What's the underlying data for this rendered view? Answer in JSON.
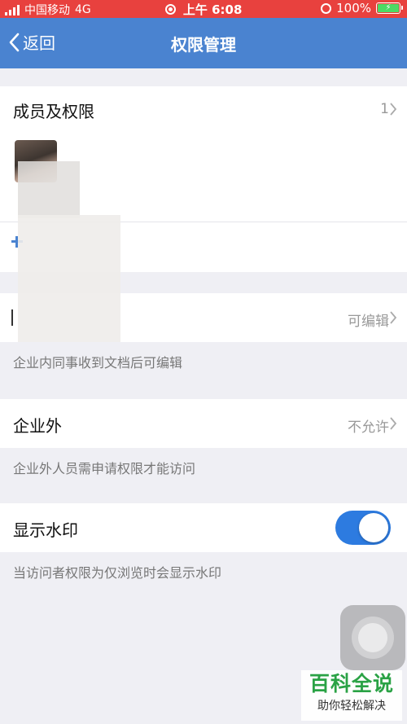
{
  "status_bar": {
    "carrier": "中国移动",
    "network": "4G",
    "time": "上午 6:08",
    "battery": "100%"
  },
  "nav": {
    "back_label": "返回",
    "title": "权限管理"
  },
  "members": {
    "label": "成员及权限",
    "count": "1"
  },
  "inside": {
    "value": "可编辑",
    "description": "企业内同事收到文档后可编辑"
  },
  "outside": {
    "label": "企业外",
    "value": "不允许",
    "description": "企业外人员需申请权限才能访问"
  },
  "watermark_setting": {
    "label": "显示水印",
    "enabled": true,
    "description": "当访问者权限为仅浏览时会显示水印"
  },
  "baike_watermark": {
    "title": "百科全说",
    "subtitle": "助你轻松解决"
  },
  "colors": {
    "status_bar": "#e8413e",
    "nav_bar": "#4a83d0",
    "toggle_on": "#2d7be0",
    "watermark_green": "#2aa245"
  }
}
